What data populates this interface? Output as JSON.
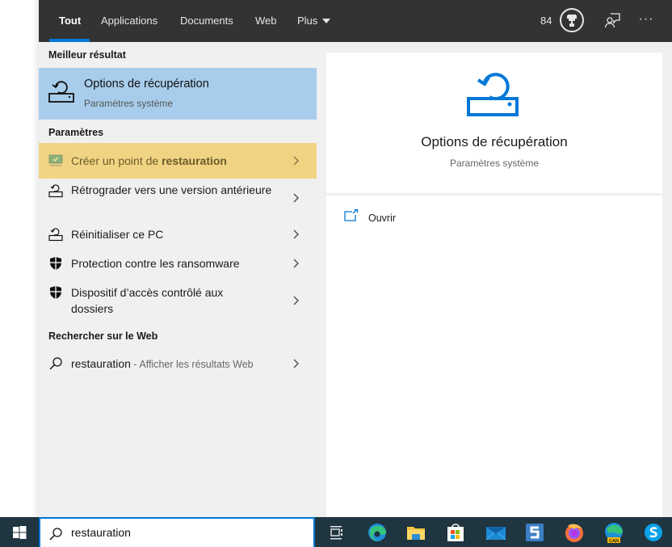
{
  "topbar": {
    "tabs": [
      {
        "label": "Tout",
        "active": true
      },
      {
        "label": "Applications",
        "active": false
      },
      {
        "label": "Documents",
        "active": false
      },
      {
        "label": "Web",
        "active": false
      },
      {
        "label": "Plus",
        "active": false,
        "has_dropdown": true
      }
    ],
    "points": "84",
    "icons": [
      "trophy-icon",
      "feedback-icon",
      "more-icon"
    ],
    "more_label": "···"
  },
  "best_match": {
    "header": "Meilleur résultat",
    "title": "Options de récupération",
    "subtitle": "Paramètres système",
    "icon": "recovery-icon"
  },
  "settings": {
    "header": "Paramètres",
    "items": [
      {
        "label_pre": "Créer un point de ",
        "label_bold": "restauration",
        "icon": "system-protection-icon",
        "highlighted": true
      },
      {
        "label": "Rétrograder vers une version antérieure",
        "icon": "recovery-icon"
      },
      {
        "label": "Réinitialiser ce PC",
        "icon": "recovery-icon"
      },
      {
        "label": "Protection contre les ransomware",
        "icon": "shield-icon"
      },
      {
        "label": "Dispositif d’accès contrôlé aux dossiers",
        "icon": "shield-icon"
      }
    ]
  },
  "web": {
    "header": "Rechercher sur le Web",
    "query": "restauration",
    "suffix": " - Afficher les résultats Web",
    "icon": "search-icon"
  },
  "preview": {
    "title": "Options de récupération",
    "subtitle": "Paramètres système",
    "actions": [
      {
        "label": "Ouvrir",
        "icon": "open-icon"
      }
    ]
  },
  "taskbar": {
    "search_value": "restauration",
    "apps": [
      "task-view",
      "edge",
      "file-explorer",
      "microsoft-store",
      "mail",
      "snagit",
      "firefox",
      "edge-canary",
      "skype"
    ],
    "edge_canary_badge": "CAN"
  },
  "colors": {
    "accent": "#0078d7",
    "best_highlight": "#a8cdec",
    "item_highlight": "#f1d483",
    "topbar": "#333333",
    "taskbar": "#1f3540"
  }
}
